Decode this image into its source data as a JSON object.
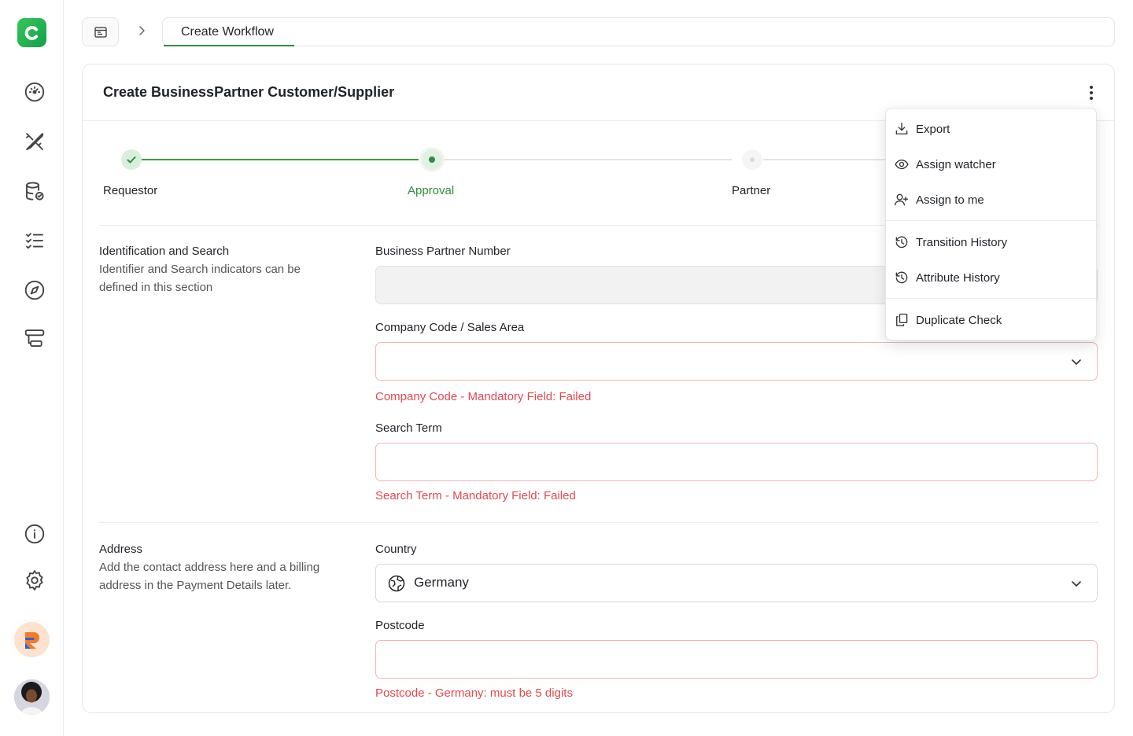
{
  "breadcrumb": {
    "tab_label": "Create Workflow"
  },
  "card": {
    "title": "Create BusinessPartner Customer/Supplier"
  },
  "stepper": {
    "steps": [
      {
        "label": "Requestor",
        "state": "done"
      },
      {
        "label": "Approval",
        "state": "current"
      },
      {
        "label": "Partner",
        "state": "pending"
      }
    ]
  },
  "sections": {
    "identification": {
      "title": "Identification and Search",
      "description": "Identifier and Search indicators can be defined in this section",
      "fields": {
        "bp_number": {
          "label": "Business Partner Number",
          "value": ""
        },
        "company_code": {
          "label": "Company Code / Sales Area",
          "value": "",
          "error": "Company Code - Mandatory Field: Failed"
        },
        "search_term": {
          "label": "Search Term",
          "value": "",
          "error": "Search Term - Mandatory Field: Failed"
        }
      }
    },
    "address": {
      "title": "Address",
      "description": "Add the contact address here and a billing address in the Payment Details later.",
      "fields": {
        "country": {
          "label": "Country",
          "value": "Germany"
        },
        "postcode": {
          "label": "Postcode",
          "value": "",
          "error": "Postcode - Germany: must be 5 digits"
        }
      }
    }
  },
  "menu": {
    "items": [
      {
        "label": "Export",
        "icon": "download-icon"
      },
      {
        "label": "Assign watcher",
        "icon": "eye-icon"
      },
      {
        "label": "Assign to me",
        "icon": "user-plus-icon"
      },
      {
        "label": "Transition History",
        "icon": "history-icon"
      },
      {
        "label": "Attribute History",
        "icon": "history-icon"
      },
      {
        "label": "Duplicate Check",
        "icon": "copy-icon"
      }
    ]
  },
  "colors": {
    "accent": "#2f8f3a",
    "error": "#e5484d",
    "error_border": "#f0b6b6"
  }
}
